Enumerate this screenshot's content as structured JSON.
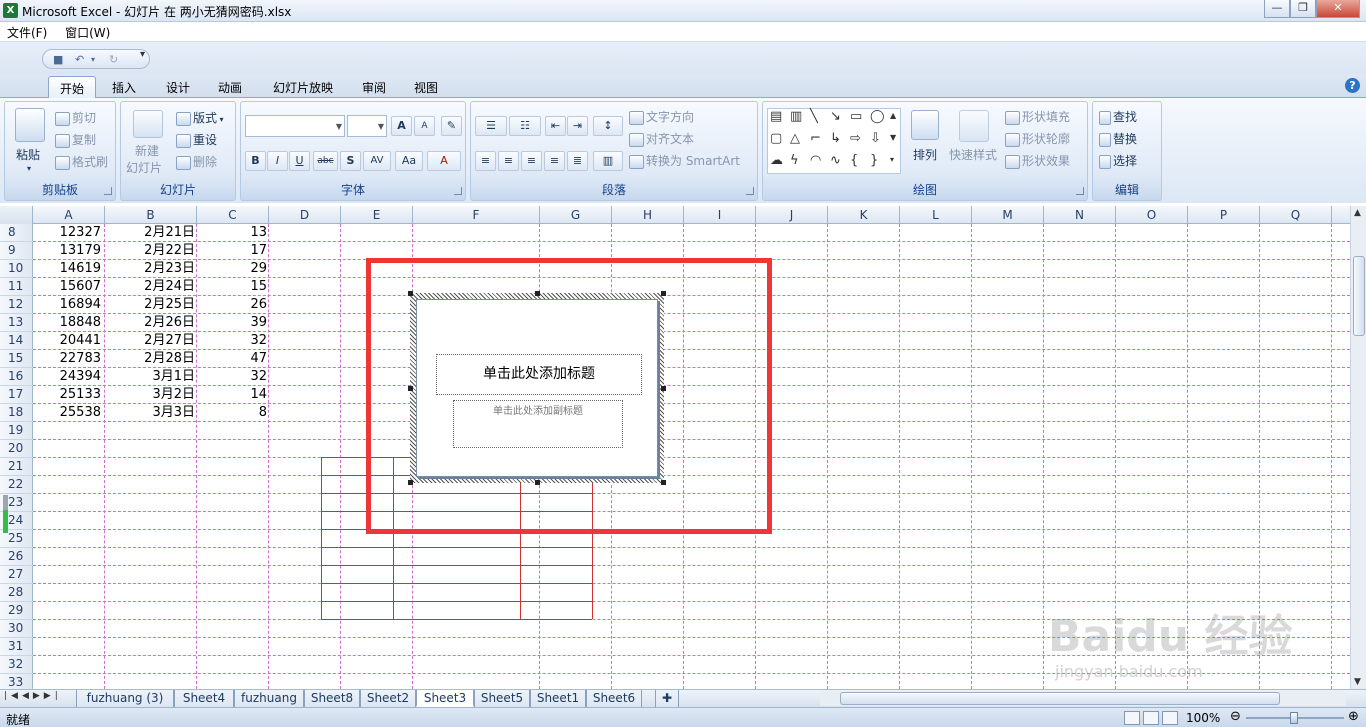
{
  "window": {
    "title": "Microsoft Excel - 幻灯片 在 两小无猜网密码.xlsx",
    "app_icon": "X",
    "buttons": [
      "—",
      "❐",
      "✕"
    ]
  },
  "menu": [
    "文件(F)",
    "窗口(W)"
  ],
  "tabs": [
    "开始",
    "插入",
    "设计",
    "动画",
    "幻灯片放映",
    "审阅",
    "视图"
  ],
  "help": "?",
  "ribbon": {
    "clipboard": {
      "label": "剪贴板",
      "paste": "粘贴",
      "cut": "剪切",
      "copy": "复制",
      "format_painter": "格式刷"
    },
    "slides": {
      "label": "幻灯片",
      "new_slide": "新建",
      "new_slide2": "幻灯片",
      "layout": "版式",
      "reset": "重设",
      "delete": "删除"
    },
    "font": {
      "label": "字体",
      "bold": "B",
      "italic": "I",
      "underline": "U",
      "strike": "abc",
      "shadow": "S",
      "spacing": "AV",
      "case": "Aa",
      "color": "A",
      "grow": "A",
      "shrink": "A"
    },
    "paragraph": {
      "label": "段落",
      "text_direction": "文字方向",
      "align_text": "对齐文本",
      "smartart": "转换为 SmartArt"
    },
    "drawing": {
      "label": "绘图",
      "arrange": "排列",
      "quick_styles": "快速样式",
      "shape_fill": "形状填充",
      "shape_outline": "形状轮廓",
      "shape_effects": "形状效果"
    },
    "editing": {
      "label": "编辑",
      "find": "查找",
      "replace": "替换",
      "select": "选择"
    }
  },
  "columns": [
    "A",
    "B",
    "C",
    "D",
    "E",
    "F",
    "G",
    "H",
    "I",
    "J",
    "K",
    "L",
    "M",
    "N",
    "O",
    "P",
    "Q"
  ],
  "rows": [
    "8",
    "9",
    "10",
    "11",
    "12",
    "13",
    "14",
    "15",
    "16",
    "17",
    "18",
    "19",
    "20",
    "21",
    "22",
    "23",
    "24",
    "25",
    "26",
    "27",
    "28",
    "29",
    "30",
    "31",
    "32",
    "33"
  ],
  "data": [
    [
      "12327",
      "2月21日",
      "13"
    ],
    [
      "13179",
      "2月22日",
      "17"
    ],
    [
      "14619",
      "2月23日",
      "29"
    ],
    [
      "15607",
      "2月24日",
      "15"
    ],
    [
      "16894",
      "2月25日",
      "26"
    ],
    [
      "18848",
      "2月26日",
      "39"
    ],
    [
      "20441",
      "2月27日",
      "32"
    ],
    [
      "22783",
      "2月28日",
      "47"
    ],
    [
      "24394",
      "3月1日",
      "32"
    ],
    [
      "25133",
      "3月2日",
      "14"
    ],
    [
      "25538",
      "3月3日",
      "8"
    ]
  ],
  "slide": {
    "title_placeholder": "单击此处添加标题",
    "subtitle_placeholder": "单击此处添加副标题"
  },
  "sheets": [
    "fuzhuang (3)",
    "Sheet4",
    "fuzhuang",
    "Sheet8",
    "Sheet2",
    "Sheet3",
    "Sheet5",
    "Sheet1",
    "Sheet6"
  ],
  "active_sheet": "Sheet3",
  "status": {
    "ready": "就绪",
    "zoom": "100%"
  },
  "watermark": {
    "brand": "Baidu 经验",
    "url": "jingyan.baidu.com"
  }
}
